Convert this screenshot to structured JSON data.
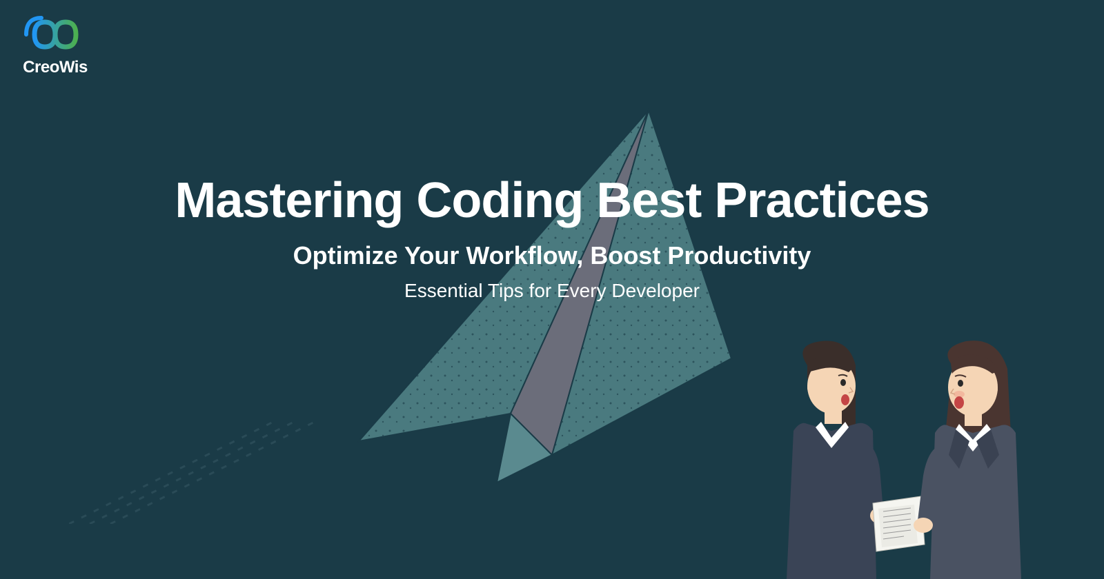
{
  "logo": {
    "brand_name": "CreoWis"
  },
  "content": {
    "title": "Mastering Coding Best Practices",
    "subtitle": "Optimize Your Workflow, Boost Productivity",
    "tagline": "Essential Tips for Every Developer"
  },
  "colors": {
    "background": "#1a3b47",
    "text": "#ffffff",
    "airplane_primary": "#4a7a7f",
    "airplane_secondary": "#6b6d7a",
    "logo_gradient_start": "#2196f3",
    "logo_gradient_end": "#4caf50"
  },
  "icons": {
    "logo": "infinity-loop-icon",
    "background_decoration": "paper-airplane-icon",
    "illustration": "two-people-talking-icon"
  }
}
